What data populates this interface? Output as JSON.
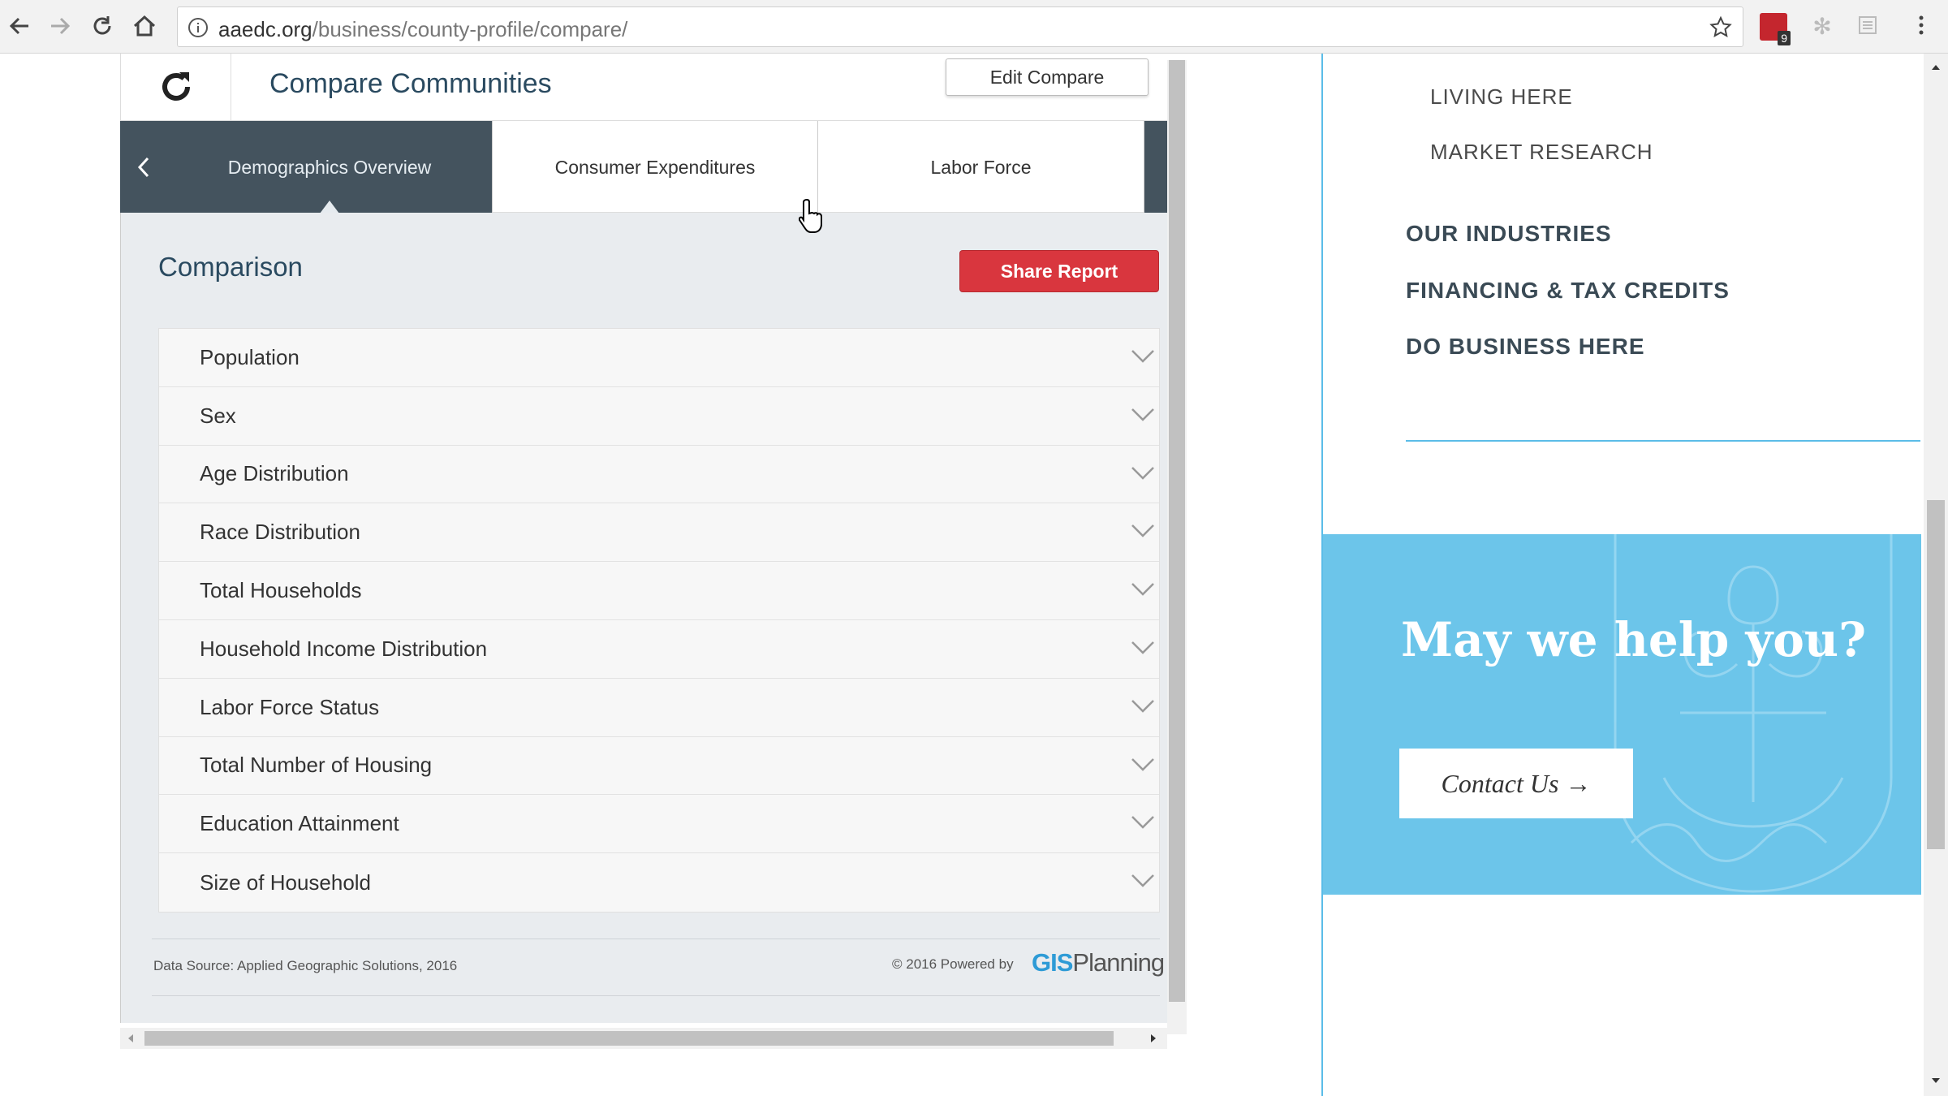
{
  "browser": {
    "url_domain": "aaedc.org",
    "url_path": "/business/county-profile/compare/",
    "extension_badge": "9"
  },
  "header": {
    "title": "Compare Communities",
    "edit_label": "Edit Compare"
  },
  "tabs": [
    {
      "label": "Demographics Overview",
      "active": true
    },
    {
      "label": "Consumer Expenditures",
      "active": false
    },
    {
      "label": "Labor Force",
      "active": false
    }
  ],
  "comparison": {
    "title": "Comparison",
    "share_label": "Share Report",
    "items": [
      "Population",
      "Sex",
      "Age Distribution",
      "Race Distribution",
      "Total Households",
      "Household Income Distribution",
      "Labor Force Status",
      "Total Number of Housing",
      "Education Attainment",
      "Size of Household"
    ]
  },
  "footer": {
    "data_source": "Data Source: Applied Geographic Solutions, 2016",
    "powered": "© 2016 Powered by",
    "logo_gis": "GIS",
    "logo_planning": "Planning"
  },
  "sidebar": {
    "sub_links": [
      "LIVING HERE",
      "MARKET RESEARCH"
    ],
    "main_links": [
      "OUR INDUSTRIES",
      "FINANCING & TAX CREDITS",
      "DO BUSINESS HERE"
    ]
  },
  "help": {
    "title": "May we help you?",
    "contact_label": "Contact Us →"
  },
  "colors": {
    "accent_blue": "#6cc5ea",
    "tab_active": "#44535e",
    "share_red": "#d9363e"
  }
}
